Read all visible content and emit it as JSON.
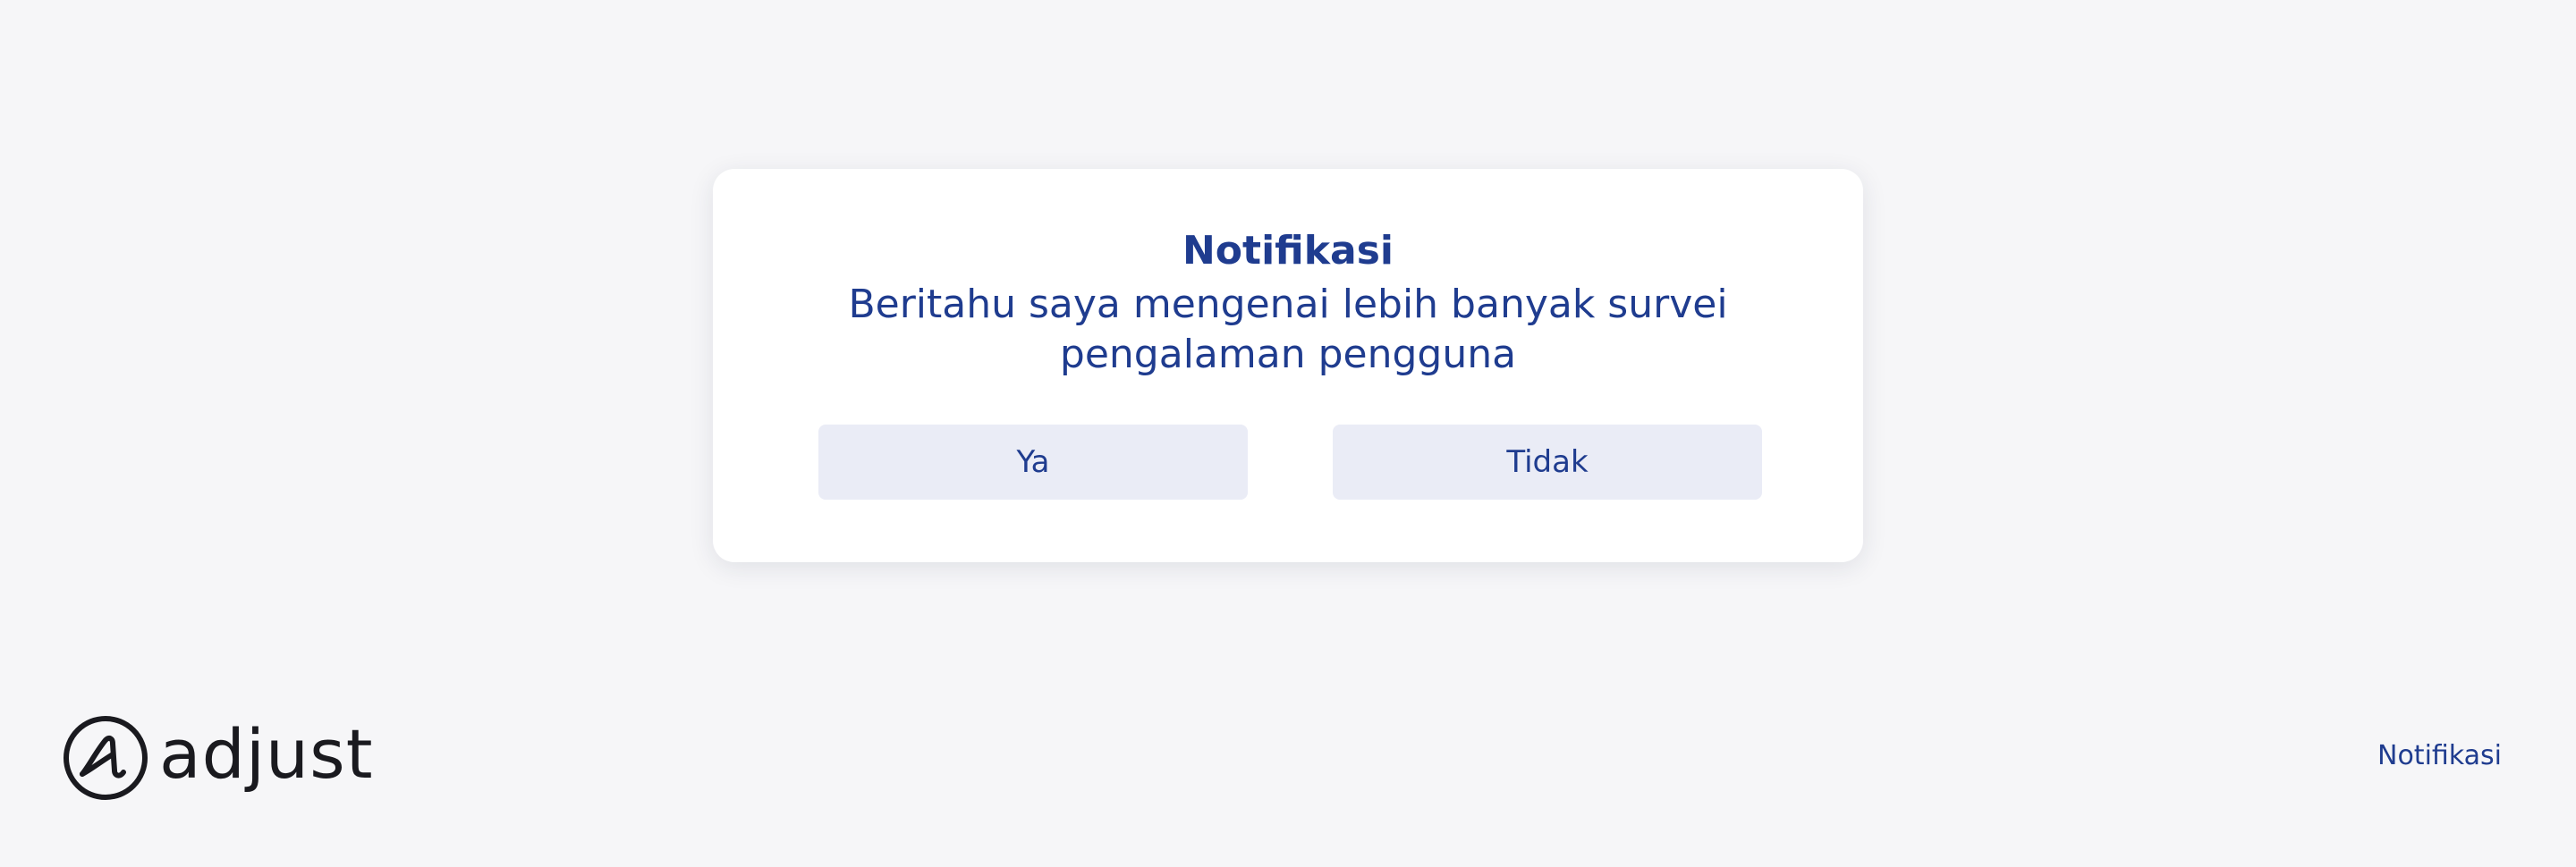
{
  "dialog": {
    "title": "Notifikasi",
    "message": "Beritahu saya mengenai lebih banyak survei pengalaman pengguna",
    "yes_label": "Ya",
    "no_label": "Tidak"
  },
  "brand": {
    "logo_text": "adjust",
    "logo_icon": "adjust-logo-icon"
  },
  "footer": {
    "link_label": "Notifikasi"
  },
  "colors": {
    "background": "#f6f6f8",
    "card": "#ffffff",
    "accent": "#1f3c8f",
    "button_bg": "#eaecf6",
    "logo": "#1a1a1f"
  }
}
